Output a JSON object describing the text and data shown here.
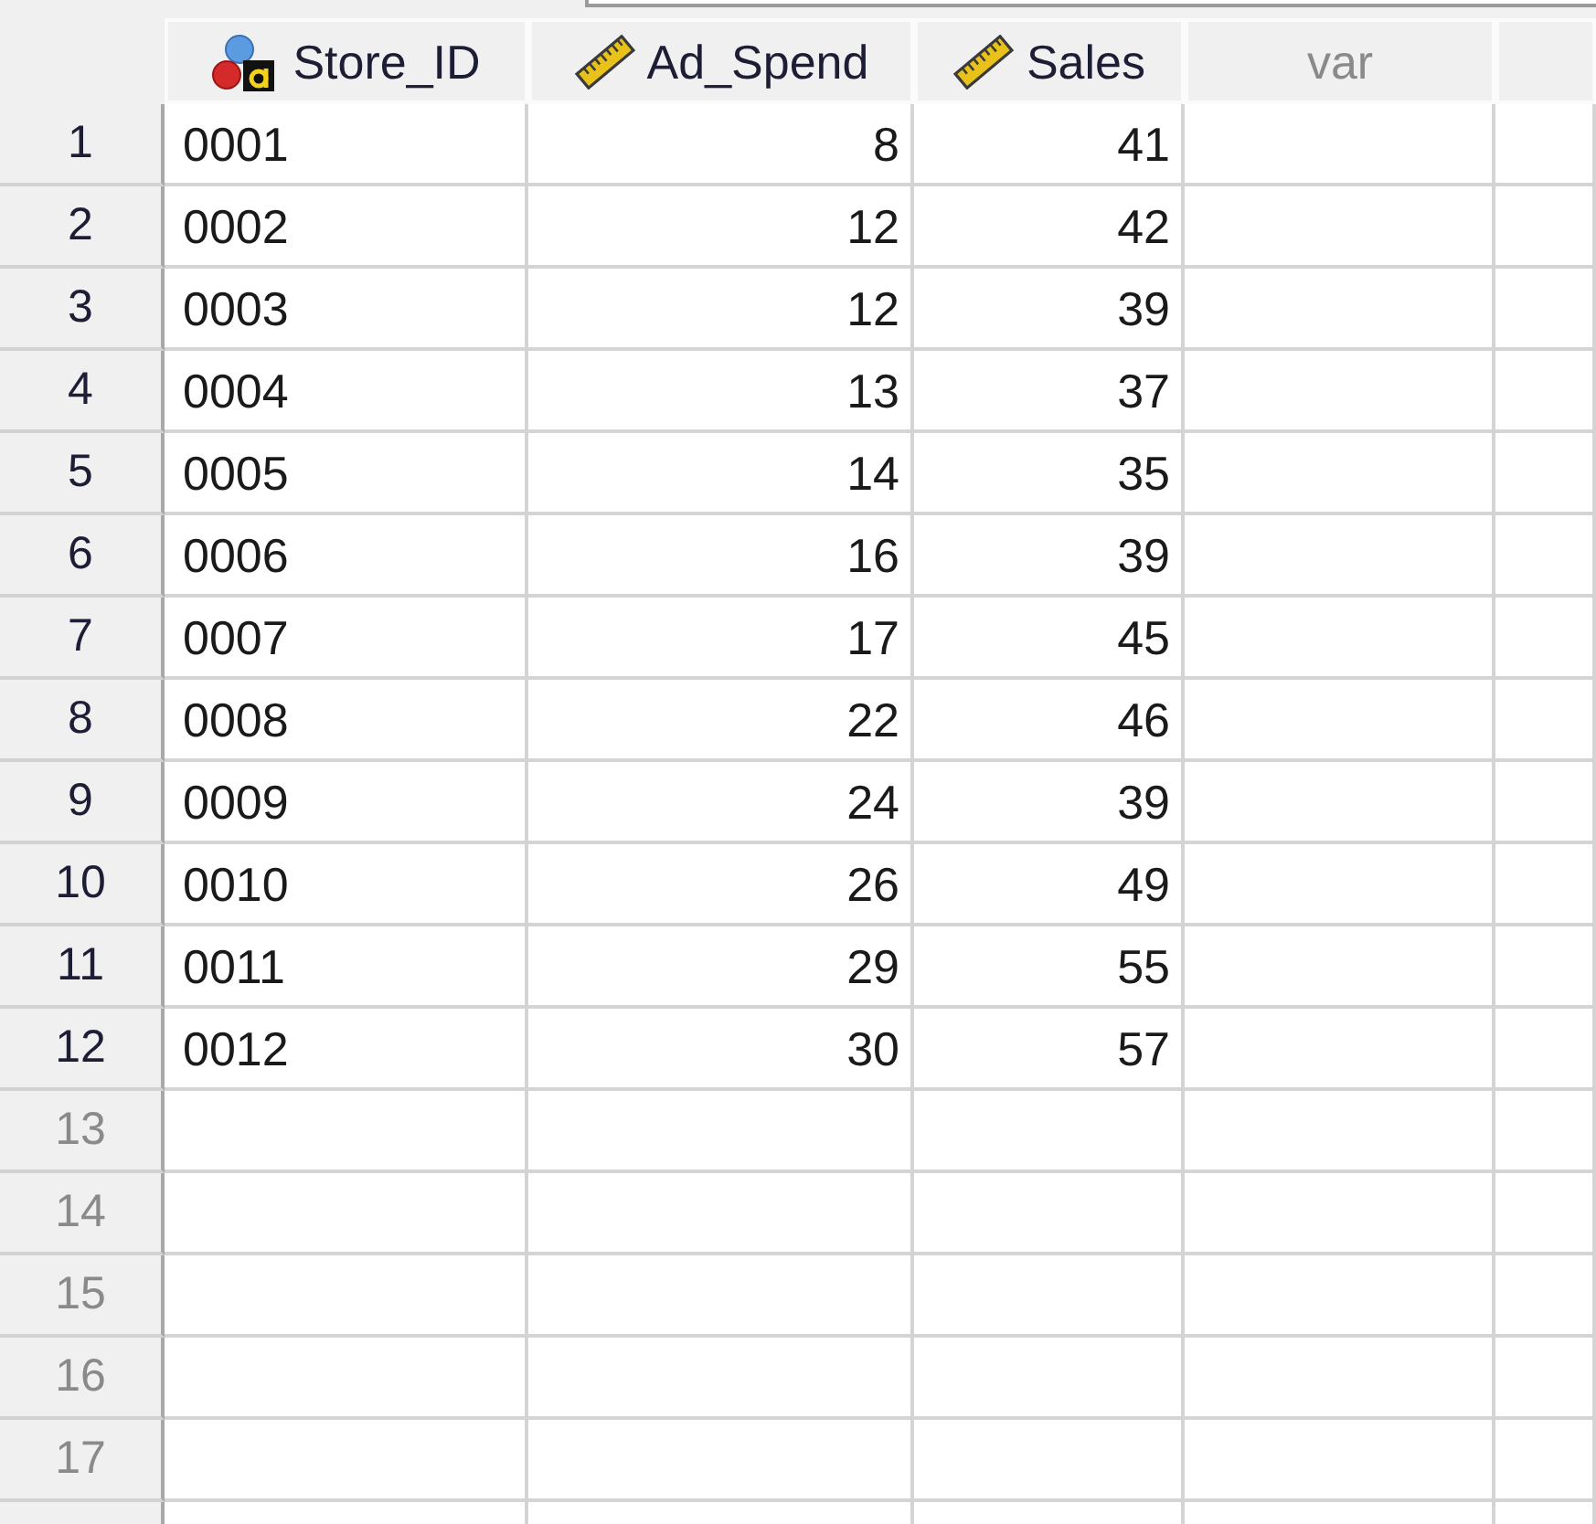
{
  "data_view": {
    "columns": [
      {
        "name": "Store_ID",
        "kind": "string"
      },
      {
        "name": "Ad_Spend",
        "kind": "scale"
      },
      {
        "name": "Sales",
        "kind": "scale"
      },
      {
        "name": "var",
        "kind": "unused"
      },
      {
        "kind": "unused"
      }
    ],
    "rows": [
      {
        "number": "1",
        "cells": [
          "0001",
          "8",
          "41"
        ]
      },
      {
        "number": "2",
        "cells": [
          "0002",
          "12",
          "42"
        ]
      },
      {
        "number": "3",
        "cells": [
          "0003",
          "12",
          "39"
        ]
      },
      {
        "number": "4",
        "cells": [
          "0004",
          "13",
          "37"
        ]
      },
      {
        "number": "5",
        "cells": [
          "0005",
          "14",
          "35"
        ]
      },
      {
        "number": "6",
        "cells": [
          "0006",
          "16",
          "39"
        ]
      },
      {
        "number": "7",
        "cells": [
          "0007",
          "17",
          "45"
        ]
      },
      {
        "number": "8",
        "cells": [
          "0008",
          "22",
          "46"
        ]
      },
      {
        "number": "9",
        "cells": [
          "0009",
          "24",
          "39"
        ]
      },
      {
        "number": "10",
        "cells": [
          "0010",
          "26",
          "49"
        ]
      },
      {
        "number": "11",
        "cells": [
          "0011",
          "29",
          "55"
        ]
      },
      {
        "number": "12",
        "cells": [
          "0012",
          "30",
          "57"
        ]
      },
      {
        "number": "13"
      },
      {
        "number": "14"
      },
      {
        "number": "15"
      },
      {
        "number": "16"
      },
      {
        "number": "17"
      }
    ]
  }
}
